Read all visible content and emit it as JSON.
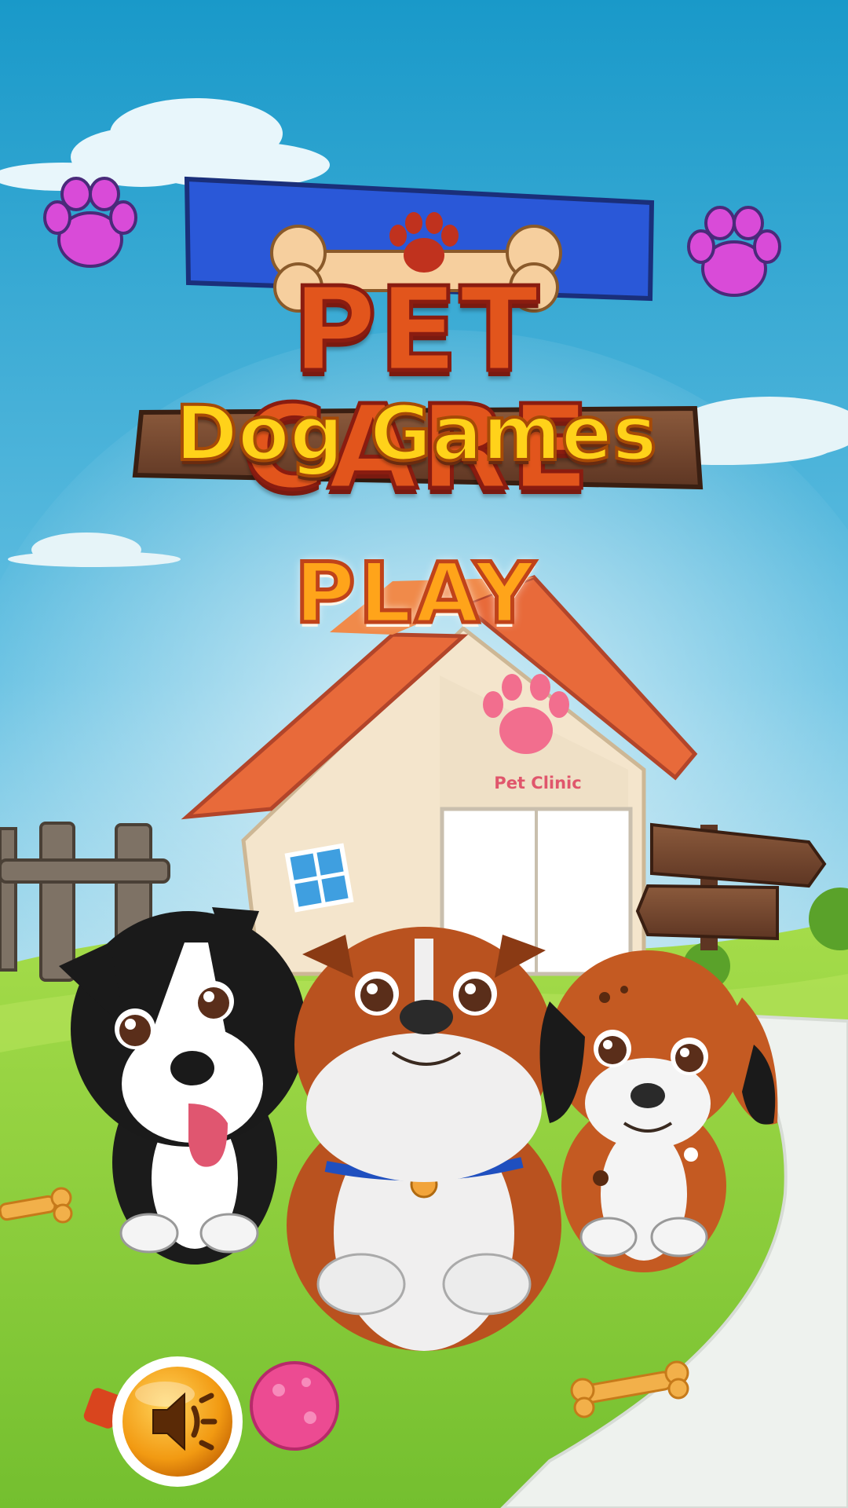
{
  "app": {
    "title_line1": "PET CARE",
    "title_line2": "Dog Games"
  },
  "menu": {
    "play_label": "PLAY"
  },
  "scene": {
    "clinic_sign": "Pet Clinic"
  },
  "controls": {
    "sound_icon": "speaker-volume-icon"
  },
  "colors": {
    "sky_top": "#1a9fcf",
    "grass": "#8ccc3a",
    "title_orange": "#e2551c",
    "subtitle_yellow": "#ffd21a",
    "play_orange": "#ffa41a",
    "paw_magenta": "#d94bd8",
    "clinic_pink": "#e0566c"
  }
}
